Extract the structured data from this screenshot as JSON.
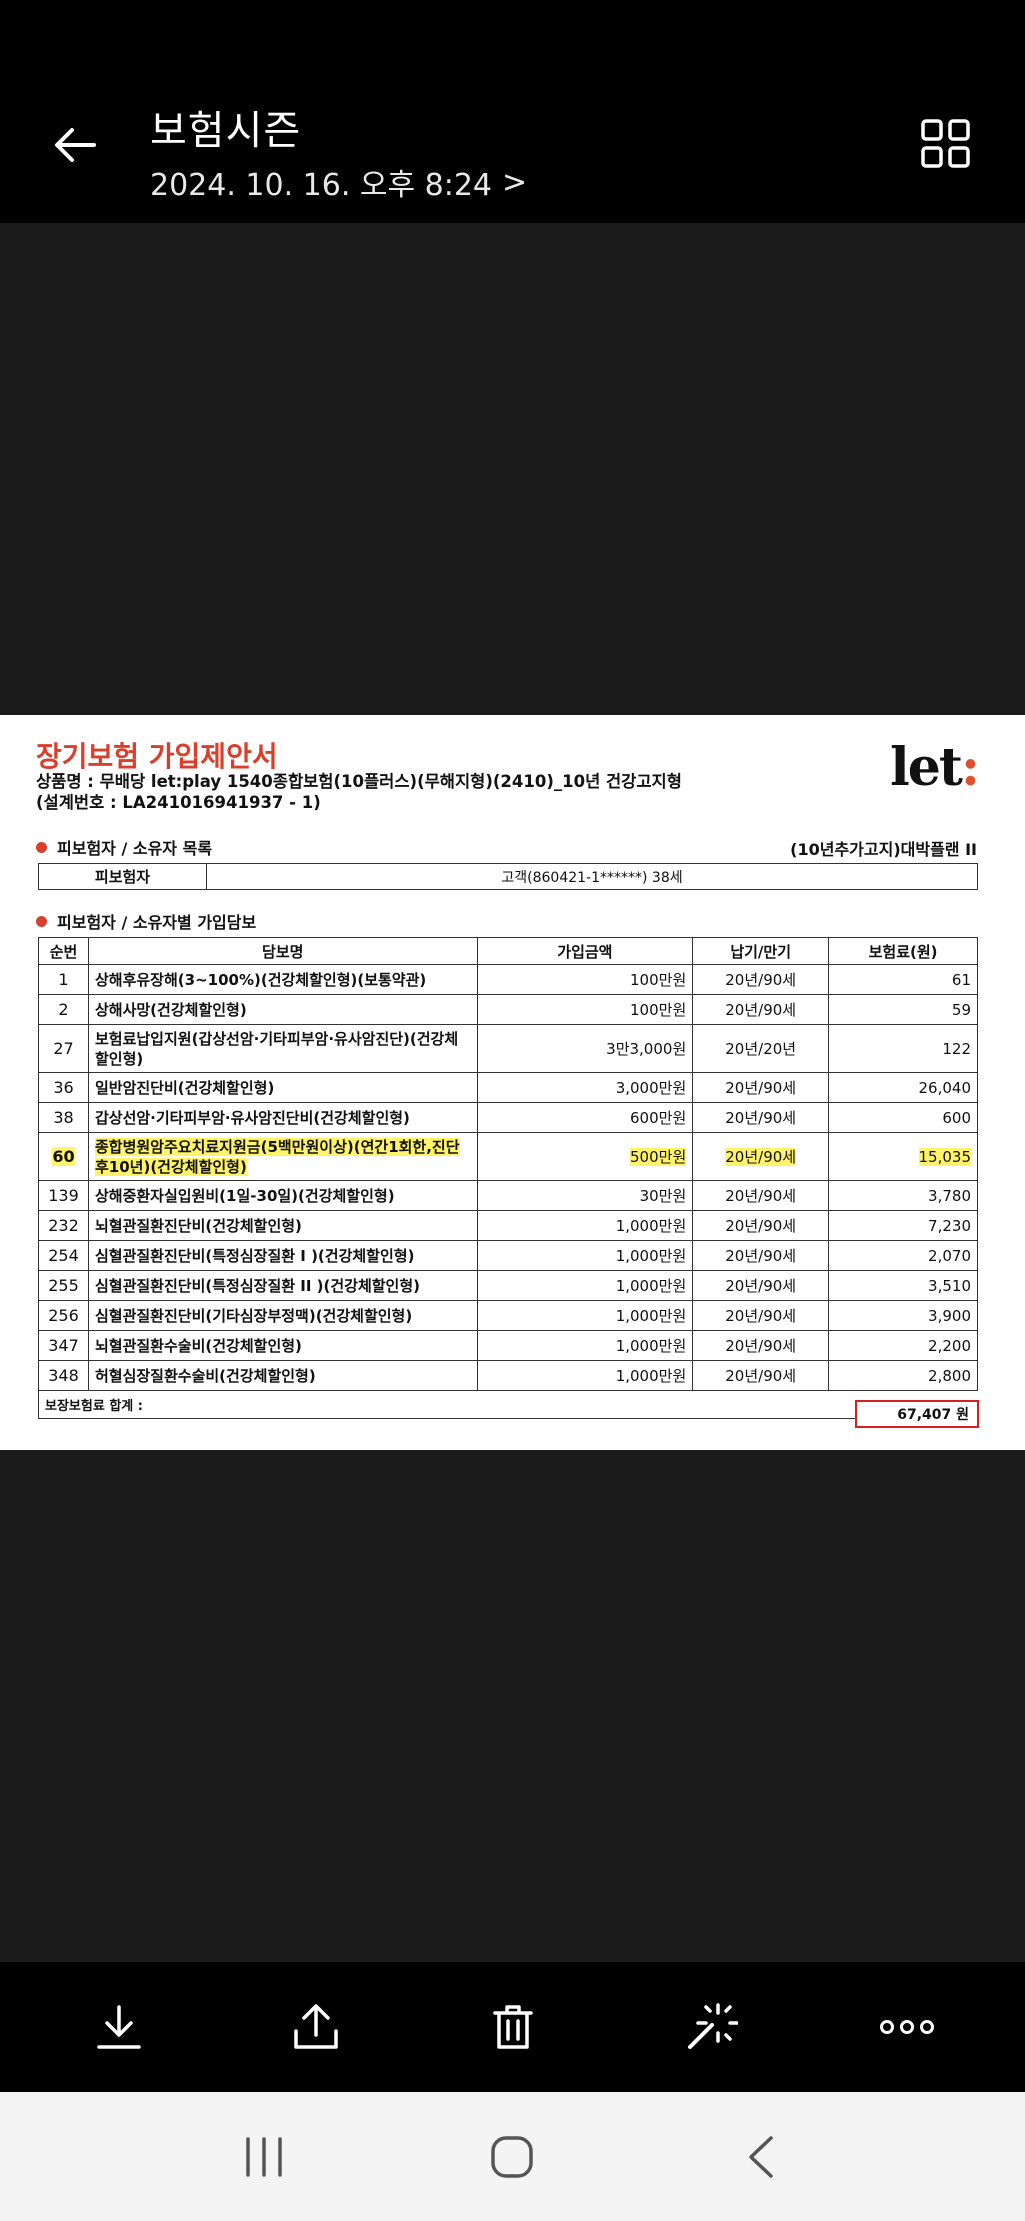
{
  "header": {
    "title": "보험시즌",
    "date": "2024. 10. 16. 오후 8:24",
    "date_chevron": ">"
  },
  "document": {
    "title": "장기보험 가입제안서",
    "product": "상품명 : 무배당 let:play 1540종합보험(10플러스)(무해지형)(2410)_10년 건강고지형",
    "design_no": "(설계번호 : LA241016941937 - 1)",
    "logo_text": "let",
    "logo_colon": ":",
    "section1": "피보험자 / 소유자 목록",
    "plan_name": "(10년추가고지)대박플랜 II",
    "insured_label": "피보험자",
    "insured_value": "고객(860421-1******)  38세",
    "section2": "피보험자 / 소유자별 가입담보",
    "columns": [
      "순번",
      "담보명",
      "가입금액",
      "납기/만기",
      "보험료(원)"
    ],
    "rows": [
      {
        "no": "1",
        "name": "상해후유장해(3~100%)(건강체할인형)(보통약관)",
        "amount": "100만원",
        "term": "20년/90세",
        "premium": "61"
      },
      {
        "no": "2",
        "name": "상해사망(건강체할인형)",
        "amount": "100만원",
        "term": "20년/90세",
        "premium": "59"
      },
      {
        "no": "27",
        "name": "보험료납입지원(갑상선암·기타피부암·유사암진단)(건강체할인형)",
        "amount": "3만3,000원",
        "term": "20년/20년",
        "premium": "122"
      },
      {
        "no": "36",
        "name": "일반암진단비(건강체할인형)",
        "amount": "3,000만원",
        "term": "20년/90세",
        "premium": "26,040"
      },
      {
        "no": "38",
        "name": "갑상선암·기타피부암·유사암진단비(건강체할인형)",
        "amount": "600만원",
        "term": "20년/90세",
        "premium": "600"
      },
      {
        "no": "60",
        "name": "종합병원암주요치료지원금(5백만원이상)(연간1회한,진단후10년)(건강체할인형)",
        "amount": "500만원",
        "term": "20년/90세",
        "premium": "15,035"
      },
      {
        "no": "139",
        "name": "상해중환자실입원비(1일-30일)(건강체할인형)",
        "amount": "30만원",
        "term": "20년/90세",
        "premium": "3,780"
      },
      {
        "no": "232",
        "name": "뇌혈관질환진단비(건강체할인형)",
        "amount": "1,000만원",
        "term": "20년/90세",
        "premium": "7,230"
      },
      {
        "no": "254",
        "name": "심혈관질환진단비(특정심장질환 I )(건강체할인형)",
        "amount": "1,000만원",
        "term": "20년/90세",
        "premium": "2,070"
      },
      {
        "no": "255",
        "name": "심혈관질환진단비(특정심장질환 II )(건강체할인형)",
        "amount": "1,000만원",
        "term": "20년/90세",
        "premium": "3,510"
      },
      {
        "no": "256",
        "name": "심혈관질환진단비(기타심장부정맥)(건강체할인형)",
        "amount": "1,000만원",
        "term": "20년/90세",
        "premium": "3,900"
      },
      {
        "no": "347",
        "name": "뇌혈관질환수술비(건강체할인형)",
        "amount": "1,000만원",
        "term": "20년/90세",
        "premium": "2,200"
      },
      {
        "no": "348",
        "name": "허혈심장질환수술비(건강체할인형)",
        "amount": "1,000만원",
        "term": "20년/90세",
        "premium": "2,800"
      }
    ],
    "total_label": "보장보험료 합계 :",
    "total_value": "67,407 원"
  },
  "icons": {
    "back": "back-arrow-icon",
    "grid": "grid-view-icon",
    "download": "download-icon",
    "share": "share-icon",
    "delete": "trash-icon",
    "enhance": "magic-wand-icon",
    "more": "more-dots-icon",
    "recents": "recents-icon",
    "home": "home-icon",
    "nav_back": "nav-back-icon"
  },
  "colors": {
    "accent_red": "#d8402b",
    "highlight": "#fff36a",
    "total_border": "#d42020"
  }
}
